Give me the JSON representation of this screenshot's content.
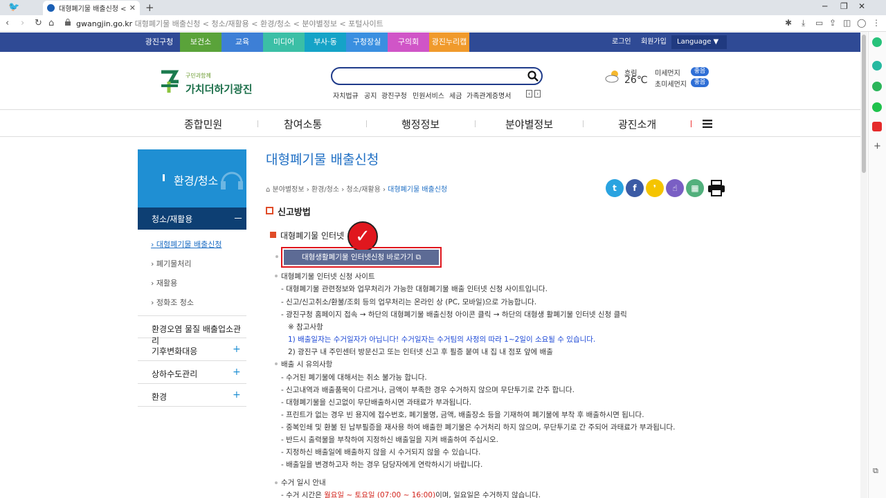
{
  "browser": {
    "tab_title": "대형폐기물 배출신청 < 청소/재",
    "url_host": "gwangjin.go.kr",
    "url_path": "대형폐기물 배출신청 < 청소/재활용 < 환경/청소 < 분야별정보 < 포털사이트"
  },
  "gnb": {
    "items": [
      {
        "label": "광진구청",
        "color": "#2f4a95"
      },
      {
        "label": "보건소",
        "color": "#5aa33a"
      },
      {
        "label": "교육",
        "color": "#3d7fd6"
      },
      {
        "label": "미디어",
        "color": "#3bbfa6"
      },
      {
        "label": "부사·동",
        "color": "#15a3c7"
      },
      {
        "label": "구청장실",
        "color": "#3a8fe0"
      },
      {
        "label": "구의회",
        "color": "#d055c7"
      },
      {
        "label": "광진누리캡",
        "color": "#f09a2c"
      }
    ],
    "login": "로그인",
    "join": "회원가입",
    "language": "Language ▼"
  },
  "header": {
    "logo_small": "구민과함께",
    "logo_text": "가치더하기광진",
    "quick_links": [
      "자치법규",
      "공지",
      "광진구청",
      "민원서비스",
      "세금",
      "가족관계증명서"
    ],
    "weather": {
      "state": "흐림",
      "temp": "26℃"
    },
    "dust": [
      {
        "label": "미세먼지",
        "grade": "좋음"
      },
      {
        "label": "초미세먼지",
        "grade": "좋음"
      }
    ]
  },
  "main_nav": [
    "종합민원",
    "참여소통",
    "행정정보",
    "분야별정보",
    "광진소개"
  ],
  "sidebar": {
    "head": "환경/청소",
    "sub": "청소/재활용",
    "sub_icon": "－",
    "links": [
      "대형폐기물 배출신청",
      "폐기물처리",
      "재활용",
      "정화조 청소"
    ],
    "rows": [
      {
        "label": "환경오염 물질 배출업소관리",
        "icon": ""
      },
      {
        "label": "기후변화대응",
        "icon": "+"
      },
      {
        "label": "상하수도관리",
        "icon": "+"
      },
      {
        "label": "환경",
        "icon": "+"
      }
    ]
  },
  "content": {
    "title": "대형폐기물 배출신청",
    "breadcrumb": {
      "path": "분야별정보 › 환경/청소 › 청소/재활용 › ",
      "current": "대형폐기물 배출신청"
    },
    "section": "신고방법",
    "subsection": "대형폐기물 인터넷",
    "check": "✓",
    "go_button": "대형생활폐기물 인터넷신청 바로가기 ⧉",
    "lines": [
      "대형폐기물 인터넷 신청 사이트",
      "- 대형폐기물 관련정보와 업무처리가 가능한 대형폐기물 배출 인터넷 신청 사이트입니다.",
      "- 신고/신고취소/환불/조회 등의 업무처리는 온라인 상 (PC, 모바일)으로 가능합니다.",
      "- 광진구청 홈페이지 접속 → 하단의 대형폐기물 배출신청 아이콘 클릭 → 하단의 대형생 활폐기물 인터넷 신청 클릭",
      "※ 참고사항",
      "1) 배출일자는 수거일자가 아닙니다! 수거일자는 수거팀의 사정의 따라 1~2일이 소요될 수 있습니다.",
      "2) 광진구 내 주민센터 방문신고 또는 인터넷 신고 후 필증 붙여 내 집 내 점포 앞에 배출",
      "배출 시 유의사항",
      "- 수거된 폐기물에 대해서는 취소 불가능 합니다.",
      "- 신고내역과 배출품목이 다르거나, 금액이 부족한 경우 수거하지 않으며 무단투기로 간주 합니다.",
      "- 대형폐기물을 신고없이 무단배출하시면 과태료가 부과됩니다.",
      "- 프린트가 없는 경우 빈 용지에 접수번호, 폐기물명, 금액, 배출장소 등을 기재하여 폐기물에 부착 후 배출하시면 됩니다.",
      "- 중복인쇄 및 환불 된 납부필증을 재사용 하여 배출한 폐기물은 수거처리 하지 않으며, 무단투기로 간 주되어 과태료가 부과됩니다.",
      "- 반드시 출력물을 부착하여 지정하신 배출일을 지켜 배출하여 주십시오.",
      "- 지정하신 배출일에 배출하지 않을 시 수거되지 않을 수 있습니다.",
      "- 배출일을 변경하고자 하는 경우 담당자에게 연락하시기 바랍니다.",
      "수거 일시 안내"
    ],
    "last_line": {
      "prefix": "- 수거 시간은 ",
      "highlight": "월요일 ~ 토요일 (07:00 ~ 16:00)",
      "suffix": "이며, 일요일은 수거하지 않습니다."
    },
    "sns": [
      {
        "name": "twitter",
        "color": "#2aa3e0",
        "glyph": "t"
      },
      {
        "name": "facebook",
        "color": "#3b5ba5",
        "glyph": "f"
      },
      {
        "name": "kakaostory",
        "color": "#f5c400",
        "glyph": "❜"
      },
      {
        "name": "share-hand",
        "color": "#7a5fc4",
        "glyph": "☝"
      },
      {
        "name": "qr",
        "color": "#52b07c",
        "glyph": "▦"
      }
    ]
  }
}
